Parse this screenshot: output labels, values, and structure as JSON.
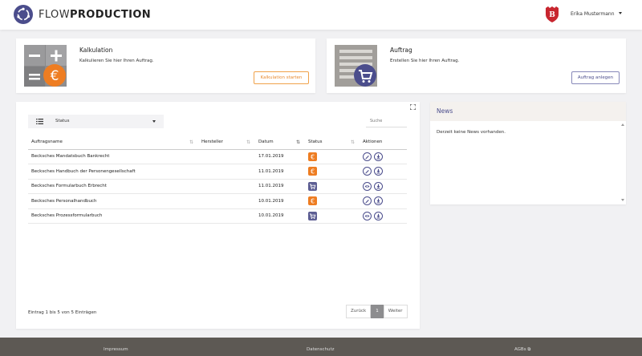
{
  "header": {
    "brand_light": "FLOW",
    "brand_bold": "PRODUCTION",
    "user_name": "Erika Mustermann"
  },
  "cards": {
    "kalkulation": {
      "title": "Kalkulation",
      "description": "Kalkulieren Sie hier Ihren Auftrag.",
      "button": "Kalkulation starten"
    },
    "auftrag": {
      "title": "Auftrag",
      "description": "Erstellen Sie hier Ihren Auftrag.",
      "button": "Auftrag anlegen"
    }
  },
  "orders": {
    "filter_label": "Status",
    "search_placeholder": "Suche",
    "columns": [
      "Auftragsname",
      "Hersteller",
      "Datum",
      "Status",
      "Aktionen"
    ],
    "rows": [
      {
        "name": "Becksches Mandatsbuch Bankrecht",
        "hersteller": "",
        "datum": "17.01.2019",
        "status": "kalkulation",
        "actions": [
          "edit",
          "download"
        ]
      },
      {
        "name": "Becksches Handbuch der Personengesellschaft",
        "hersteller": "",
        "datum": "11.01.2019",
        "status": "kalkulation",
        "actions": [
          "edit",
          "download"
        ]
      },
      {
        "name": "Becksches Formularbuch Erbrecht",
        "hersteller": "",
        "datum": "11.01.2019",
        "status": "auftrag",
        "actions": [
          "view",
          "download"
        ]
      },
      {
        "name": "Becksches Personalhandbuch",
        "hersteller": "",
        "datum": "10.01.2019",
        "status": "kalkulation",
        "actions": [
          "edit",
          "download"
        ]
      },
      {
        "name": "Becksches Prozessformularbuch",
        "hersteller": "",
        "datum": "10.01.2019",
        "status": "auftrag",
        "actions": [
          "view",
          "download"
        ]
      }
    ],
    "info": "Eintrag 1 bis 5 von 5 Einträgen",
    "pager": {
      "prev": "Zurück",
      "current": "1",
      "next": "Weiter"
    }
  },
  "news": {
    "title": "News",
    "body": "Derzeit keine News vorhanden."
  },
  "footer": {
    "impressum": "Impressum",
    "datenschutz": "Datenschutz",
    "agbs": "AGBs"
  },
  "colors": {
    "brand_purple": "#4b4d8c",
    "accent_orange": "#ee7d22",
    "footer_bg": "#5d5954"
  }
}
